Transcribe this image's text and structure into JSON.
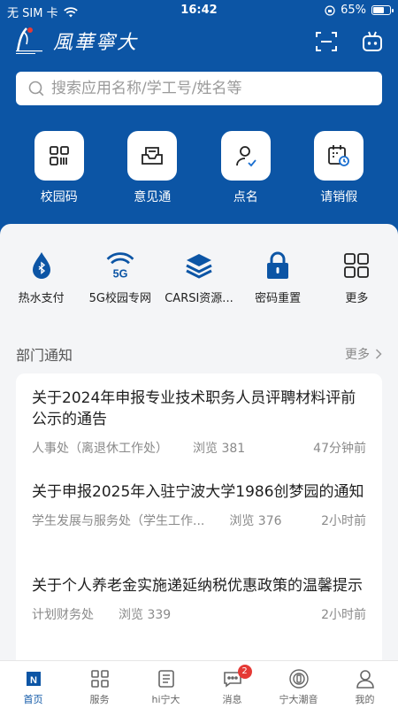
{
  "status_bar": {
    "carrier": "无 SIM 卡",
    "time": "16:42",
    "battery": "65%"
  },
  "app": {
    "brand_name": "風華寧大"
  },
  "search": {
    "placeholder": "搜索应用名称/学工号/姓名等"
  },
  "quick_actions": [
    {
      "label": "校园码",
      "icon": "qr-code-icon"
    },
    {
      "label": "意见通",
      "icon": "feedback-inbox-icon"
    },
    {
      "label": "点名",
      "icon": "user-check-icon"
    },
    {
      "label": "请销假",
      "icon": "calendar-clock-icon"
    }
  ],
  "services": [
    {
      "label": "热水支付",
      "icon": "water-drop-bluetooth-icon"
    },
    {
      "label": "5G校园专网",
      "icon": "5g-signal-icon"
    },
    {
      "label": "CARSI资源...",
      "icon": "layers-icon"
    },
    {
      "label": "密码重置",
      "icon": "lock-icon"
    },
    {
      "label": "更多",
      "icon": "grid-icon"
    }
  ],
  "notices": {
    "title": "部门通知",
    "more": "更多",
    "items": [
      {
        "title": "关于2024年申报专业技术职务人员评聘材料评前公示的通告",
        "dept": "人事处（离退休工作处）",
        "views": "浏览 381",
        "time": "47分钟前"
      },
      {
        "title": "关于申报2025年入驻宁波大学1986创梦园的通知",
        "dept": "学生发展与服务处（学生工作...",
        "views": "浏览 376",
        "time": "2小时前"
      },
      {
        "title": "关于个人养老金实施递延纳税优惠政策的温馨提示",
        "dept": "计划财务处",
        "views": "浏览 339",
        "time": "2小时前"
      }
    ]
  },
  "tabbar": [
    {
      "label": "首页",
      "icon": "home-icon",
      "active": true
    },
    {
      "label": "服务",
      "icon": "services-grid-icon"
    },
    {
      "label": "hi宁大",
      "icon": "document-icon"
    },
    {
      "label": "消息",
      "icon": "message-icon",
      "badge": "2"
    },
    {
      "label": "宁大潮音",
      "icon": "radio-icon"
    },
    {
      "label": "我的",
      "icon": "profile-icon"
    }
  ],
  "colors": {
    "primary": "#0c55a5",
    "badge": "#e53935"
  }
}
